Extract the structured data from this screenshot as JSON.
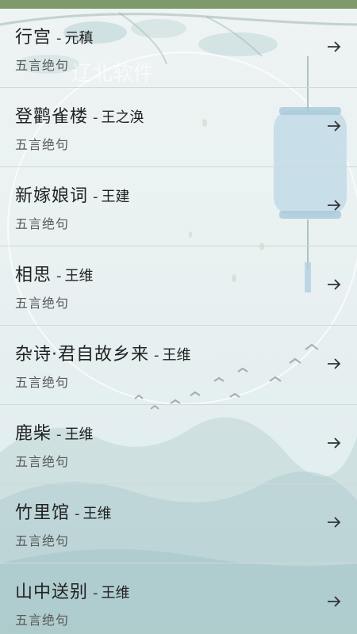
{
  "list": {
    "items": [
      {
        "title": "行宫",
        "author": "元稹",
        "genre": "五言绝句"
      },
      {
        "title": "登鹳雀楼",
        "author": "王之涣",
        "genre": "五言绝句"
      },
      {
        "title": "新嫁娘词",
        "author": "王建",
        "genre": "五言绝句"
      },
      {
        "title": "相思",
        "author": "王维",
        "genre": "五言绝句"
      },
      {
        "title": "杂诗·君自故乡来",
        "author": "王维",
        "genre": "五言绝句"
      },
      {
        "title": "鹿柴",
        "author": "王维",
        "genre": "五言绝句"
      },
      {
        "title": "竹里馆",
        "author": "王维",
        "genre": "五言绝句"
      },
      {
        "title": "山中送别",
        "author": "王维",
        "genre": "五言绝句"
      }
    ]
  },
  "separator": "-",
  "watermark": "辽北软件",
  "colors": {
    "topbar": "#7e9a6b",
    "divider": "#d3d8d8",
    "title_text": "#222222",
    "genre_text": "#5a5a5a"
  },
  "icons": {
    "row_arrow": "arrow-right-icon"
  }
}
